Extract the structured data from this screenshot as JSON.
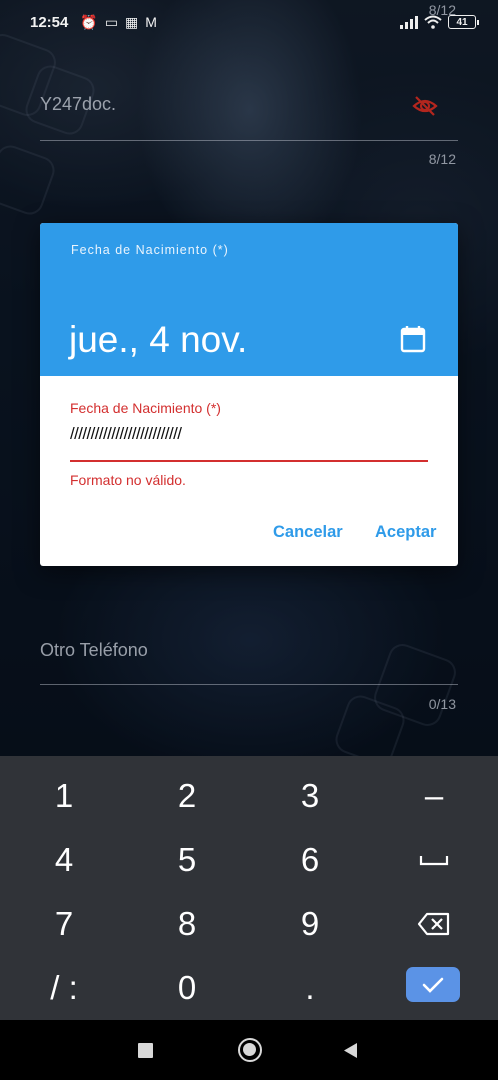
{
  "status_bar": {
    "time": "12:54",
    "icons": [
      "alarm-icon",
      "laptop-icon",
      "qr-icon",
      "mail-icon"
    ],
    "battery": "41"
  },
  "background_form": {
    "top_counter": "8/12",
    "password_value": "Y247doc.",
    "password_counter": "8/12",
    "other_phone_label": "Otro Teléfono",
    "other_phone_counter": "0/13"
  },
  "dialog": {
    "header_label": "Fecha de Nacimiento (*)",
    "selected_date": "jue., 4 nov.",
    "field_label": "Fecha de Nacimiento (*)",
    "field_value": "///////////////////////////",
    "error_text": "Formato no válido.",
    "cancel_label": "Cancelar",
    "accept_label": "Aceptar",
    "accent_color": "#2f9be9",
    "error_color": "#d32f2f"
  },
  "keyboard": {
    "rows": [
      [
        "1",
        "2",
        "3",
        "–"
      ],
      [
        "4",
        "5",
        "6",
        "␣"
      ],
      [
        "7",
        "8",
        "9",
        "⌫"
      ],
      [
        "/ :",
        "0",
        ".",
        "✓"
      ]
    ]
  }
}
